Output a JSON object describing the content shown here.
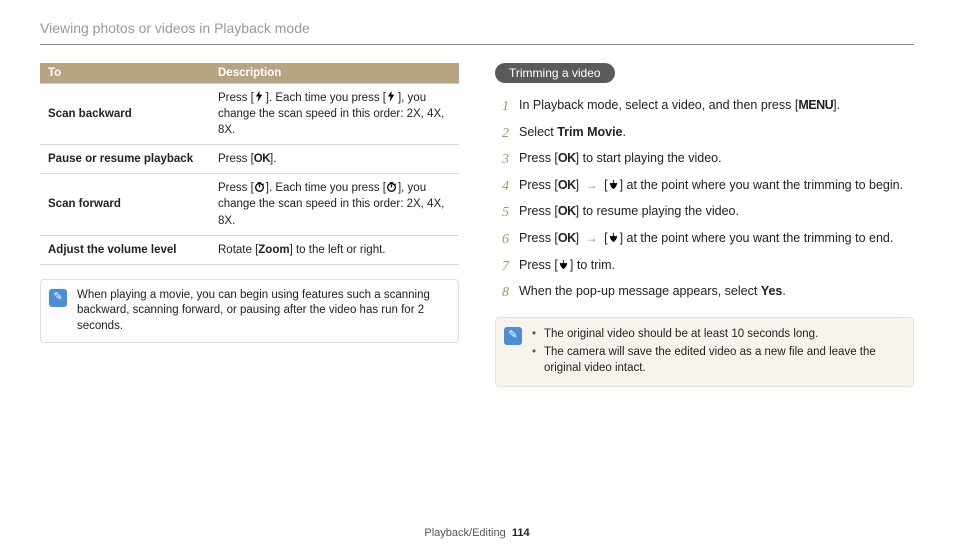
{
  "page": {
    "title": "Viewing photos or videos in Playback mode",
    "footer_section": "Playback/Editing",
    "footer_page": "114"
  },
  "table": {
    "header_to": "To",
    "header_desc": "Description",
    "rows": [
      {
        "op": "Scan backward",
        "desc_pre": "Press [",
        "desc_mid": "]. Each time you press [",
        "desc_post": "], you change the scan speed in this order: 2X, 4X, 8X.",
        "icon": "flash"
      },
      {
        "op": "Pause or resume playback",
        "desc_pre": "Press [",
        "desc_post": "].",
        "icon": "ok"
      },
      {
        "op": "Scan forward",
        "desc_pre": "Press [",
        "desc_mid": "]. Each time you press [",
        "desc_post": "], you change the scan speed in this order: 2X, 4X, 8X.",
        "icon": "timer"
      },
      {
        "op": "Adjust the volume level",
        "desc_pre": "Rotate [",
        "desc_bold": "Zoom",
        "desc_post": "] to the left or right."
      }
    ]
  },
  "note_left": {
    "text": "When playing a movie, you can begin using features such a scanning backward, scanning forward, or pausing after the video has run for 2 seconds."
  },
  "section_title": "Trimming a video",
  "steps": {
    "1": {
      "pre": "In Playback mode, select a video, and then press [",
      "btn": "MENU",
      "post": "]."
    },
    "2": {
      "pre": "Select ",
      "bold": "Trim Movie",
      "post": "."
    },
    "3": {
      "pre": "Press [",
      "btn": "OK",
      "post": "] to start playing the video."
    },
    "4": {
      "pre": "Press [",
      "btn": "OK",
      "mid1": "] ",
      "mid2": " [",
      "icon2": "macro",
      "post": "] at the point where you want the trimming to begin."
    },
    "5": {
      "pre": "Press [",
      "btn": "OK",
      "post": "] to resume playing the video."
    },
    "6": {
      "pre": "Press [",
      "btn": "OK",
      "mid1": "] ",
      "mid2": " [",
      "icon2": "macro",
      "post": "] at the point where you want the trimming to end."
    },
    "7": {
      "pre": "Press [",
      "icon": "macro",
      "post": "] to trim."
    },
    "8": {
      "pre": "When the pop-up message appears, select ",
      "bold": "Yes",
      "post": "."
    }
  },
  "note_right": {
    "b1": "The original video should be at least 10 seconds long.",
    "b2": "The camera will save the edited video as a new file and leave the original video intact."
  },
  "labels": {
    "ok": "OK",
    "menu": "MENU"
  }
}
